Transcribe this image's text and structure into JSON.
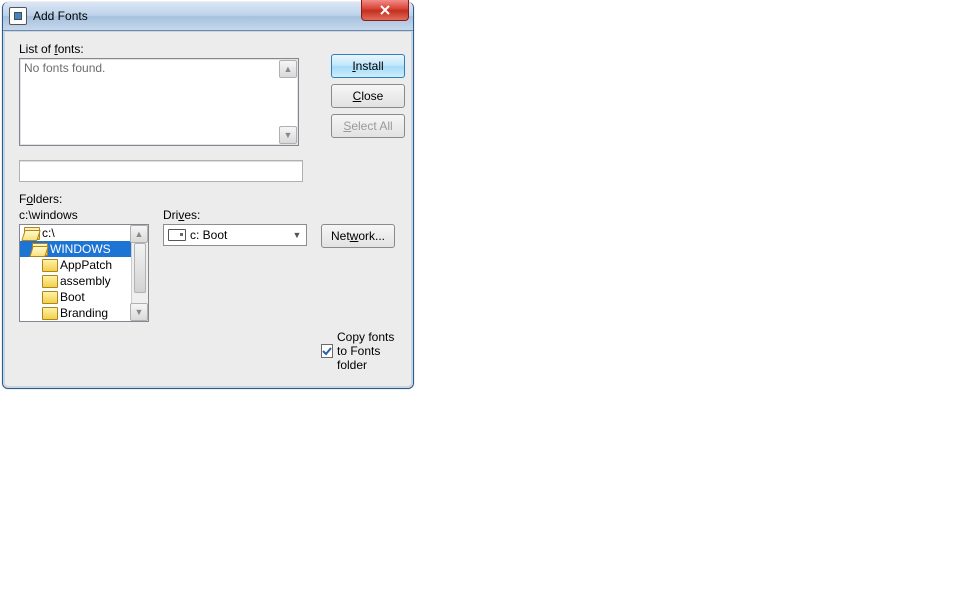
{
  "window": {
    "title": "Add Fonts"
  },
  "fonts": {
    "label_pre": "List of ",
    "label_u": "f",
    "label_post": "onts:",
    "empty_text": "No fonts found."
  },
  "buttons": {
    "install_u": "I",
    "install_post": "nstall",
    "close_u": "C",
    "close_post": "lose",
    "select_all_u": "S",
    "select_all_post": "elect All",
    "network_pre": "Net",
    "network_u": "w",
    "network_post": "ork..."
  },
  "folders": {
    "label_pre": "F",
    "label_u": "o",
    "label_post": "lders:",
    "path": "c:\\windows",
    "items": [
      {
        "label": "c:\\",
        "open": true,
        "indent": 0,
        "selected": false
      },
      {
        "label": "WINDOWS",
        "open": true,
        "indent": 1,
        "selected": true
      },
      {
        "label": "AppPatch",
        "open": false,
        "indent": 2,
        "selected": false
      },
      {
        "label": "assembly",
        "open": false,
        "indent": 2,
        "selected": false
      },
      {
        "label": "Boot",
        "open": false,
        "indent": 2,
        "selected": false
      },
      {
        "label": "Branding",
        "open": false,
        "indent": 2,
        "selected": false
      }
    ]
  },
  "drives": {
    "label_pre": "Dri",
    "label_u": "v",
    "label_post": "es:",
    "selected": "c: Boot"
  },
  "copy": {
    "checked": true,
    "label": "Copy fonts to Fonts folder"
  }
}
